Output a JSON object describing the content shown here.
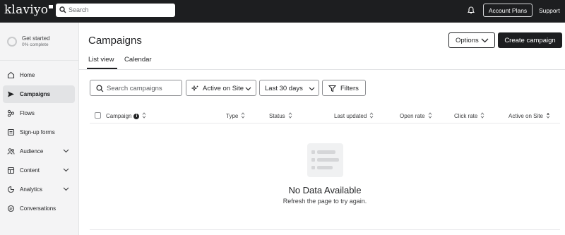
{
  "topbar": {
    "logo": "klaviyo",
    "search_placeholder": "Search",
    "account_plans": "Account Plans",
    "support": "Support"
  },
  "sidebar": {
    "get_started": {
      "title": "Get started",
      "progress": "0% complete"
    },
    "items": [
      {
        "label": "Home",
        "icon": "home-icon",
        "active": false,
        "expandable": false
      },
      {
        "label": "Campaigns",
        "icon": "send-icon",
        "active": true,
        "expandable": false
      },
      {
        "label": "Flows",
        "icon": "flows-icon",
        "active": false,
        "expandable": false
      },
      {
        "label": "Sign-up forms",
        "icon": "form-icon",
        "active": false,
        "expandable": false
      },
      {
        "label": "Audience",
        "icon": "people-icon",
        "active": false,
        "expandable": true
      },
      {
        "label": "Content",
        "icon": "content-icon",
        "active": false,
        "expandable": true
      },
      {
        "label": "Analytics",
        "icon": "analytics-icon",
        "active": false,
        "expandable": true
      },
      {
        "label": "Conversations",
        "icon": "chat-icon",
        "active": false,
        "expandable": false
      }
    ]
  },
  "main": {
    "title": "Campaigns",
    "options_label": "Options",
    "create_label": "Create campaign",
    "tabs": [
      {
        "label": "List view",
        "active": true
      },
      {
        "label": "Calendar",
        "active": false
      }
    ],
    "filters": {
      "search_placeholder": "Search campaigns",
      "active_on_site": "Active on Site",
      "date_range": "Last 30 days",
      "filters_label": "Filters"
    },
    "table": {
      "columns": [
        "Campaign",
        "Type",
        "Status",
        "Last updated",
        "Open rate",
        "Click rate",
        "Active on Site"
      ]
    },
    "empty": {
      "title": "No Data Available",
      "subtitle": "Refresh the page to try again."
    }
  },
  "colors": {
    "topbar_bg": "#1d1e20",
    "sidebar_bg": "#f4f4f5",
    "active_nav_bg": "#e2e3e5",
    "primary_button": "#1d1e20"
  }
}
